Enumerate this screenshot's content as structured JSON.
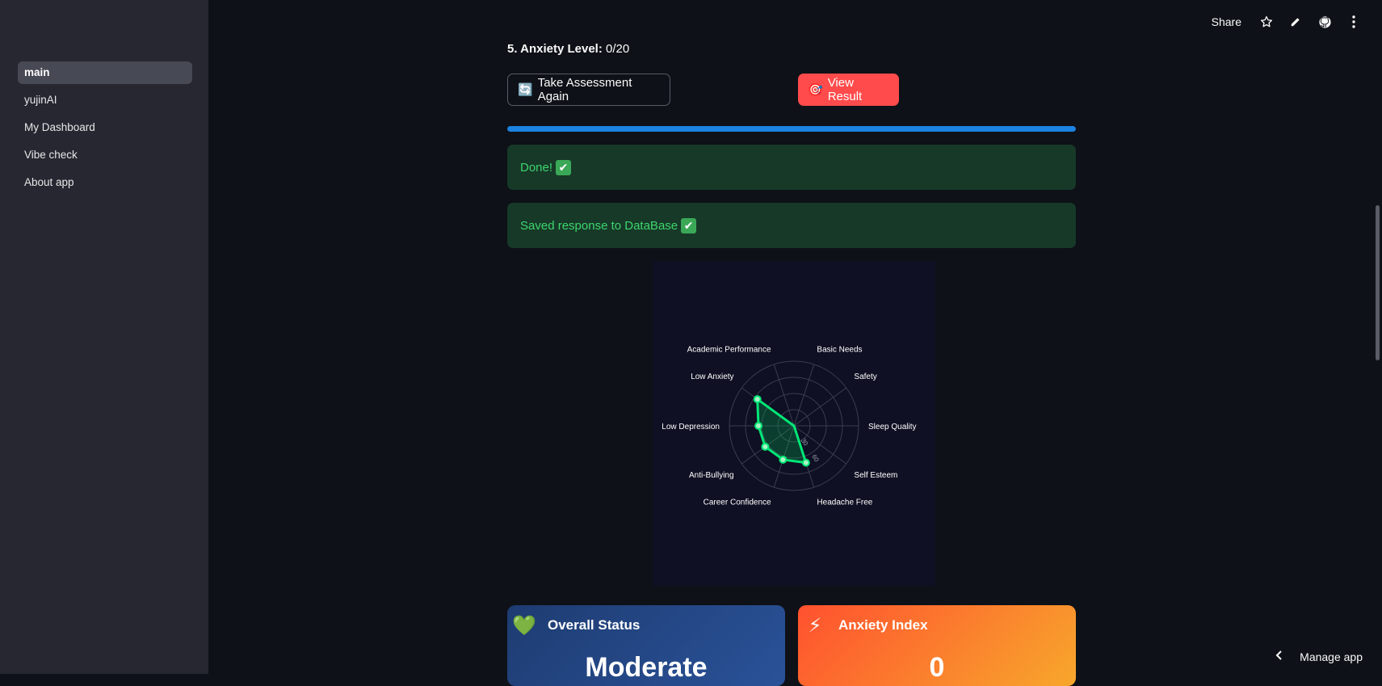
{
  "sidebar": {
    "items": [
      {
        "label": "main",
        "active": true
      },
      {
        "label": "yujinAI"
      },
      {
        "label": "My Dashboard"
      },
      {
        "label": "Vibe check"
      },
      {
        "label": "About app"
      }
    ]
  },
  "toolbar": {
    "share_label": "Share",
    "icons": [
      "star-icon",
      "pencil-icon",
      "github-icon",
      "more-vert-icon"
    ]
  },
  "main": {
    "anxiety_label": "5. Anxiety Level:",
    "anxiety_value": "0/20",
    "retake_button": {
      "emoji": "🔄",
      "label": "Take Assessment Again"
    },
    "view_result_button": {
      "emoji": "🎯",
      "label": "View Result"
    },
    "progress": 1.0,
    "alerts": [
      {
        "text": "Done! ",
        "check": "✔"
      },
      {
        "text": "Saved response to DataBase",
        "check": "✔"
      }
    ]
  },
  "chart_data": {
    "type": "radar",
    "categories": [
      "Basic Needs",
      "Safety",
      "Sleep Quality",
      "Self Esteem",
      "Headache Free",
      "Career Confidence",
      "Anti-Bullying",
      "Low Depression",
      "Low Anxiety",
      "Academic Performance"
    ],
    "values": [
      0,
      0,
      0,
      0,
      60,
      55,
      55,
      55,
      70,
      0
    ],
    "range": [
      0,
      100
    ],
    "tick_labels": [
      "30",
      "60"
    ],
    "grid": true,
    "colors": {
      "line": "#00e676",
      "fill": "#00c853",
      "grid": "#3a3d4f",
      "background": "#0f1023",
      "label": "#ffffff"
    }
  },
  "cards": [
    {
      "emoji": "💚",
      "title": "Overall Status",
      "value": "Moderate"
    },
    {
      "emoji": "⚡",
      "title": "Anxiety Index",
      "value": "0"
    }
  ],
  "footer": {
    "manage_label": "Manage app"
  }
}
